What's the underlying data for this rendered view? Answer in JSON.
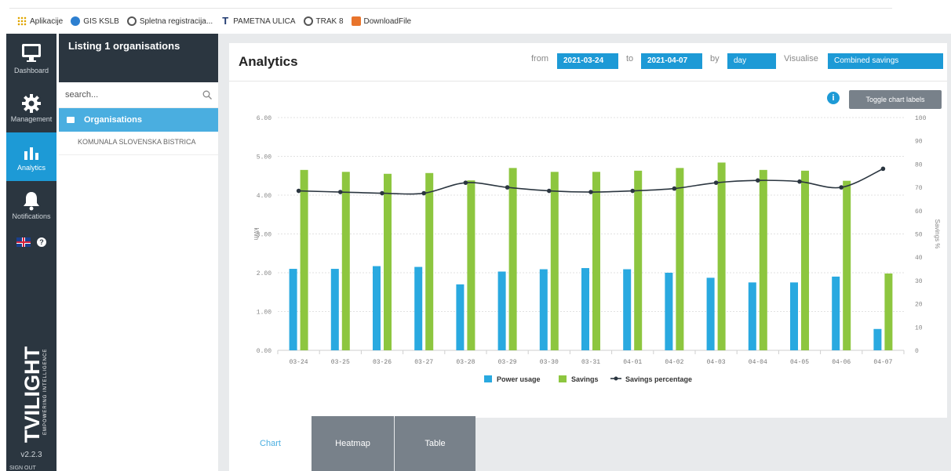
{
  "browser": {
    "bookmarks": [
      {
        "label": "Aplikacije",
        "icon": "apps-grid-icon"
      },
      {
        "label": "GIS KSLB",
        "icon": "globe-icon"
      },
      {
        "label": "Spletna registracija...",
        "icon": "globe-icon"
      },
      {
        "label": "PAMETNA ULICA",
        "icon": "t-logo-icon"
      },
      {
        "label": "TRAK 8",
        "icon": "globe-icon"
      },
      {
        "label": "DownloadFile",
        "icon": "download-icon"
      }
    ]
  },
  "nav": {
    "items": [
      {
        "label": "Dashboard",
        "icon": "monitor-icon"
      },
      {
        "label": "Management",
        "icon": "gear-icon"
      },
      {
        "label": "Analytics",
        "icon": "bar-chart-icon",
        "active": true
      },
      {
        "label": "Notifications",
        "icon": "bell-icon"
      }
    ],
    "brand": "TVILIGHT",
    "tagline": "EMPOWERING INTELLIGENCE",
    "version": "v2.2.3",
    "signout": "SIGN OUT"
  },
  "orgs": {
    "header": "Listing 1 organisations",
    "search_placeholder": "search...",
    "selected": "Organisations",
    "items": [
      "KOMUNALA SLOVENSKA BISTRICA"
    ]
  },
  "analytics": {
    "title": "Analytics",
    "from_label": "from",
    "from_date": "2021-03-24",
    "to_label": "to",
    "to_date": "2021-04-07",
    "by_label": "by",
    "by_value": "day",
    "visualise_label": "Visualise",
    "visualise_value": "Combined savings",
    "toggle_label": "Toggle chart labels",
    "info_icon": "info-icon"
  },
  "tabs": [
    {
      "label": "Chart",
      "active": true
    },
    {
      "label": "Heatmap",
      "active": false
    },
    {
      "label": "Table",
      "active": false
    }
  ],
  "colors": {
    "power": "#29a9e0",
    "savings": "#8dc63f",
    "line": "#2b3640",
    "accent": "#1d9ad6",
    "nav_bg": "#2b3640"
  },
  "chart_data": {
    "type": "bar",
    "categories": [
      "03-24",
      "03-25",
      "03-26",
      "03-27",
      "03-28",
      "03-29",
      "03-30",
      "03-31",
      "04-01",
      "04-02",
      "04-03",
      "04-04",
      "04-05",
      "04-06",
      "04-07"
    ],
    "series": [
      {
        "name": "Power usage",
        "type": "bar",
        "axis": "left",
        "values": [
          2.1,
          2.1,
          2.17,
          2.15,
          1.7,
          2.03,
          2.09,
          2.12,
          2.09,
          2.0,
          1.87,
          1.75,
          1.75,
          1.9,
          0.55
        ]
      },
      {
        "name": "Savings",
        "type": "bar",
        "axis": "left",
        "values": [
          4.65,
          4.6,
          4.55,
          4.57,
          4.38,
          4.7,
          4.6,
          4.6,
          4.63,
          4.7,
          4.84,
          4.65,
          4.63,
          4.37,
          1.98
        ]
      },
      {
        "name": "Savings percentage",
        "type": "line",
        "axis": "right",
        "values": [
          68.5,
          68,
          67.5,
          67.5,
          72,
          70,
          68.5,
          68,
          68.5,
          69.5,
          72,
          73,
          72.5,
          70,
          78
        ]
      }
    ],
    "ylabel": "kWh",
    "y2label": "Savings %",
    "ylim": [
      0,
      6
    ],
    "y2lim": [
      0,
      100
    ],
    "yticks": [
      "0.00",
      "1.00",
      "2.00",
      "3.00",
      "4.00",
      "5.00",
      "6.00"
    ],
    "y2ticks": [
      "0",
      "10",
      "20",
      "30",
      "40",
      "50",
      "60",
      "70",
      "80",
      "90",
      "100"
    ],
    "grid": true,
    "legend_position": "bottom"
  }
}
